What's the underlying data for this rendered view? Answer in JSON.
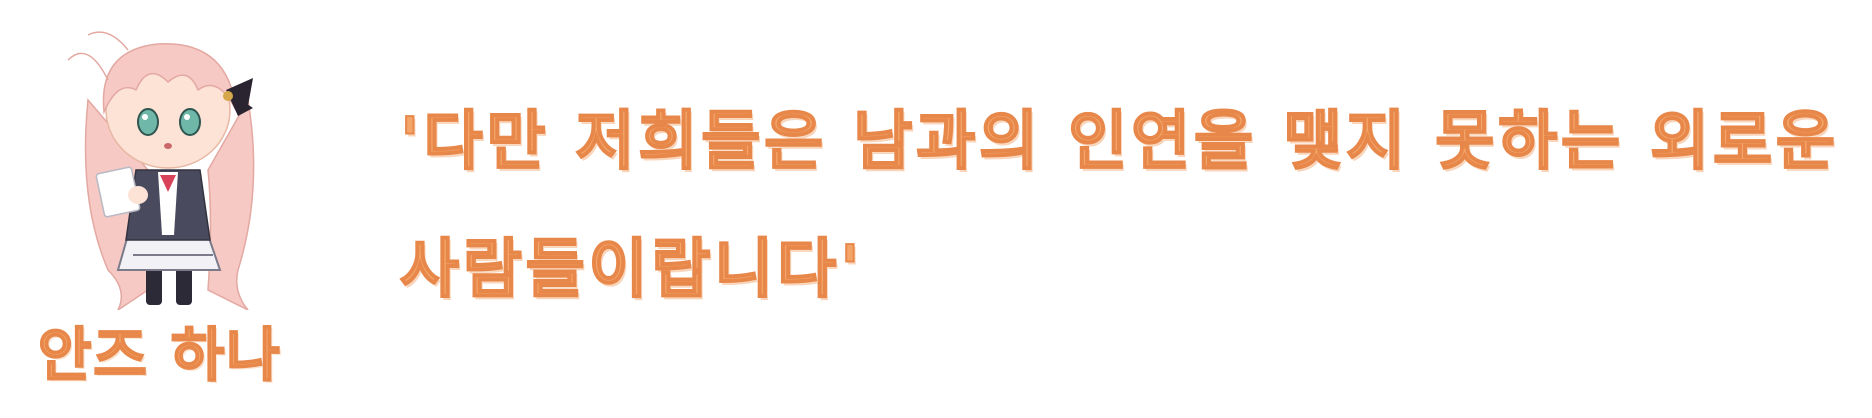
{
  "speaker": {
    "name": "안즈 하나",
    "portrait_icon": "chibi-girl-portrait-icon"
  },
  "dialogue": {
    "lines": [
      "'다만 저희들은 남과의 인연을 맺지 못하는 외로운",
      "사람들이랍니다'"
    ]
  },
  "colors": {
    "text_fill": "#f4a66a",
    "text_stroke": "#e8874a",
    "hair": "#f6c9c4",
    "outfit": "#4a4a5e",
    "ribbon": "#2a2430",
    "eyes": "#6fb7a8"
  }
}
